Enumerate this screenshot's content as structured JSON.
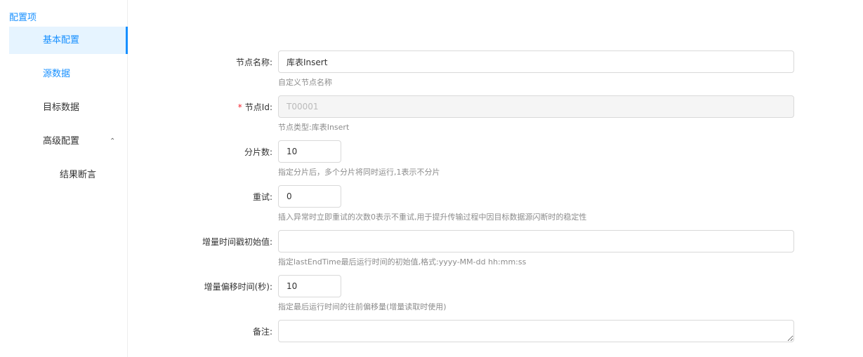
{
  "sidebar": {
    "title": "配置项",
    "items": [
      {
        "label": "基本配置"
      },
      {
        "label": "源数据"
      },
      {
        "label": "目标数据"
      },
      {
        "label": "高级配置"
      },
      {
        "label": "结果断言"
      }
    ]
  },
  "form": {
    "node_name": {
      "label": "节点名称:",
      "value": "库表Insert",
      "hint": "自定义节点名称"
    },
    "node_id": {
      "required_mark": "*",
      "label": "节点Id:",
      "value": "T00001",
      "hint": "节点类型:库表Insert"
    },
    "shards": {
      "label": "分片数:",
      "value": "10",
      "hint": "指定分片后，多个分片将同时运行,1表示不分片"
    },
    "retry": {
      "label": "重试:",
      "value": "0",
      "hint": "插入异常时立即重试的次数0表示不重试,用于提升传输过程中因目标数据源闪断时的稳定性"
    },
    "incr_ts_init": {
      "label": "增量时间戳初始值:",
      "value": "",
      "hint": "指定lastEndTime最后运行时间的初始值,格式:yyyy-MM-dd hh:mm:ss"
    },
    "incr_offset": {
      "label": "增量偏移时间(秒):",
      "value": "10",
      "hint": "指定最后运行时间的往前偏移量(增量读取时使用)"
    },
    "remark": {
      "label": "备注:",
      "value": ""
    }
  }
}
